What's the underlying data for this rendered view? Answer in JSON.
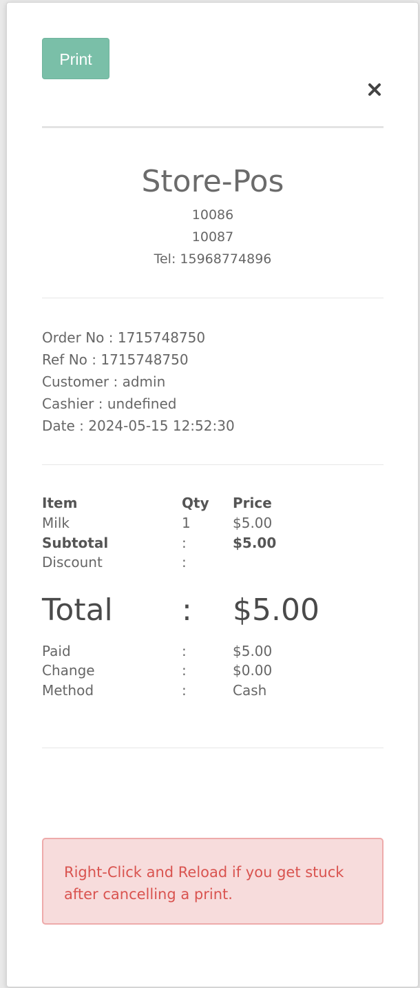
{
  "toolbar": {
    "print_label": "Print",
    "close_icon": "close-icon"
  },
  "store": {
    "name": "Store-Pos",
    "line1": "10086",
    "line2": "10087",
    "tel": "Tel: 15968774896"
  },
  "order": {
    "order_no": "Order No : 1715748750",
    "ref_no": "Ref No : 1715748750",
    "customer": "Customer : admin",
    "cashier": "Cashier : undefined",
    "date": "Date : 2024-05-15 12:52:30"
  },
  "table": {
    "headers": [
      "Item",
      "Qty",
      "Price"
    ],
    "items": [
      {
        "name": "Milk",
        "qty": "1",
        "price": "$5.00"
      }
    ]
  },
  "summary": {
    "subtotal_label": "Subtotal",
    "subtotal_sep": ":",
    "subtotal_value": "$5.00",
    "discount_label": "Discount",
    "discount_sep": ":",
    "discount_value": "",
    "total_label": "Total",
    "total_sep": ":",
    "total_value": "$5.00",
    "paid_label": "Paid",
    "paid_sep": ":",
    "paid_value": "$5.00",
    "change_label": "Change",
    "change_sep": ":",
    "change_value": "$0.00",
    "method_label": "Method",
    "method_sep": ":",
    "method_value": "Cash"
  },
  "alert": {
    "message": "Right-Click and Reload if you get stuck after cancelling a print."
  },
  "colors": {
    "print_button": "#7abfa8",
    "alert_background": "#f7dcdc",
    "alert_border": "#eeaaaa",
    "alert_text": "#d9534f"
  }
}
